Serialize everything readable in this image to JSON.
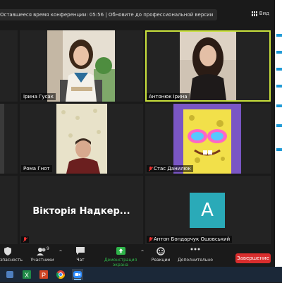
{
  "meeting": {
    "banner": "Оставшееся время конференции: 05:56 | Обновите до профессиональной версии",
    "view_label": "Вид",
    "accent_color": "#c8e03c"
  },
  "participants": [
    {
      "name": "Ірина Гусак",
      "muted": false
    },
    {
      "name": "Антонюк Ірина",
      "muted": false,
      "active_speaker": true
    },
    {
      "name": "Рома Гнот",
      "muted": false
    },
    {
      "name": "Стас Данилюк",
      "muted": true
    },
    {
      "name": "Вікторія Надкер...",
      "muted": true,
      "video": "off"
    },
    {
      "name": "Антон Бондарчук Ошовський",
      "muted": true,
      "avatar_letter": "A",
      "avatar_color": "#2aaab8"
    }
  ],
  "toolbar": {
    "security": "зпасность",
    "participants": "Участники",
    "participants_count": "9",
    "chat": "Чат",
    "share": "Демонстрация экрана",
    "reactions": "Реакции",
    "more": "Дополнительно",
    "end": "Завершение",
    "share_color": "#2fb54a",
    "end_color": "#d92d2d"
  },
  "taskbar": {
    "icons": [
      "windows-settings-icon",
      "excel-icon",
      "powerpoint-icon",
      "chrome-icon",
      "zoom-icon"
    ]
  }
}
